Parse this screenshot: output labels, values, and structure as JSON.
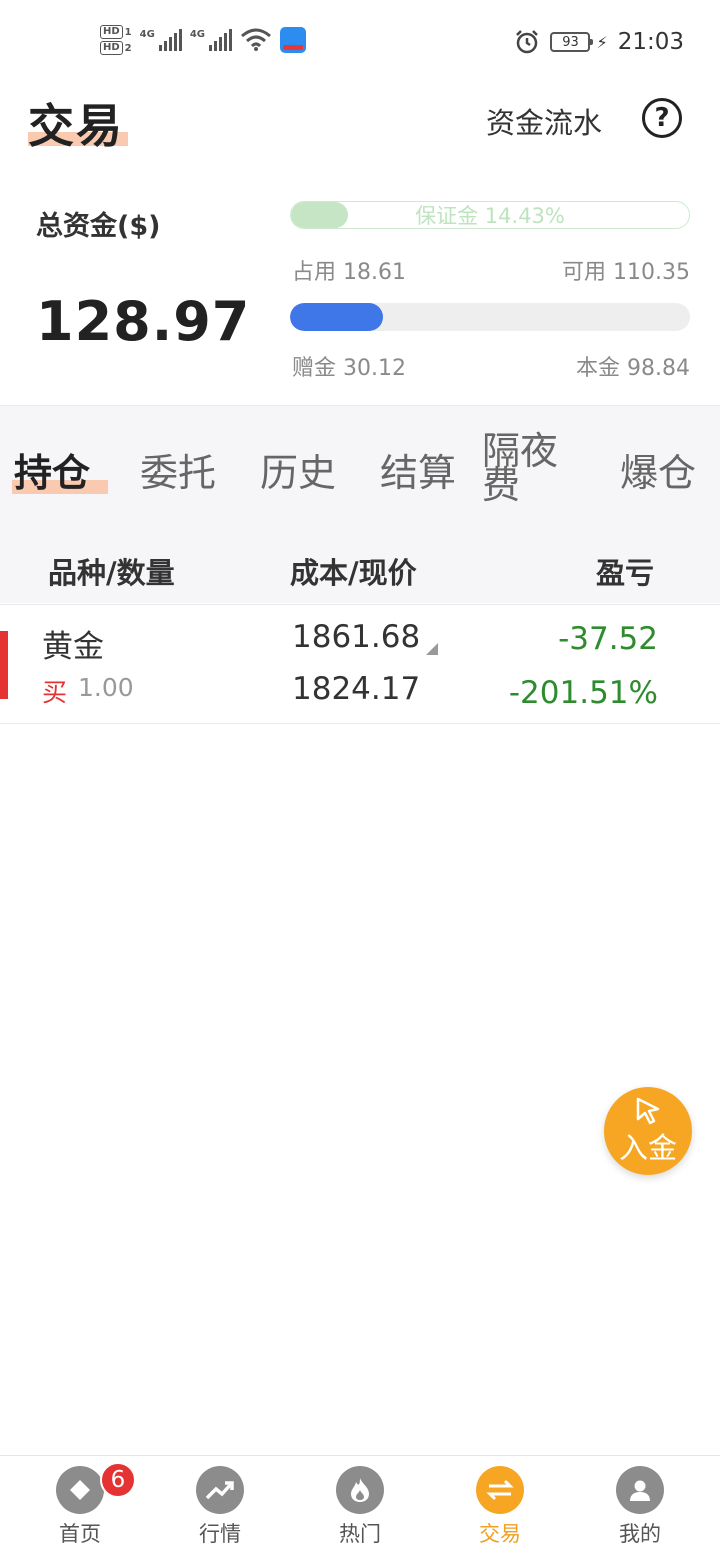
{
  "status_bar": {
    "hd1": "HD",
    "hd1_sub": "1",
    "hd2": "HD",
    "hd2_sub": "2",
    "net1": "4G",
    "net2": "4G",
    "battery": "93",
    "time": "21:03"
  },
  "header": {
    "title": "交易",
    "flow_link": "资金流水",
    "help": "?"
  },
  "funds": {
    "total_label": "总资金($)",
    "total_value": "128.97",
    "margin_label": "保证金 14.43%",
    "margin_percent": 14.43,
    "used": "占用 18.61",
    "available": "可用 110.35",
    "bonus": "赠金 30.12",
    "principal": "本金 98.84",
    "bonus_fraction": 0.2336
  },
  "tabs": {
    "items": [
      "持仓",
      "委托",
      "历史",
      "结算",
      "隔夜费",
      "爆仓"
    ],
    "active": "持仓"
  },
  "columns": {
    "instrument": "品种/数量",
    "cost_price": "成本/现价",
    "pnl": "盈亏"
  },
  "positions": [
    {
      "name": "黄金",
      "direction": "买",
      "quantity": "1.00",
      "cost": "1861.68",
      "price": "1824.17",
      "pnl": "-37.52",
      "pnl_pct": "-201.51%"
    }
  ],
  "fab": {
    "label": "入金"
  },
  "bottom_nav": {
    "items": [
      {
        "label": "首页",
        "icon": "home-icon",
        "badge": "6"
      },
      {
        "label": "行情",
        "icon": "trend-icon"
      },
      {
        "label": "热门",
        "icon": "fire-icon"
      },
      {
        "label": "交易",
        "icon": "exchange-icon"
      },
      {
        "label": "我的",
        "icon": "user-icon"
      }
    ],
    "active": "交易"
  },
  "colors": {
    "accent": "#f6a623",
    "loss_green": "#2e8b2e",
    "buy_red": "#e53232",
    "bonus_blue": "#3f76e8",
    "margin_green": "#c5e5c4"
  }
}
